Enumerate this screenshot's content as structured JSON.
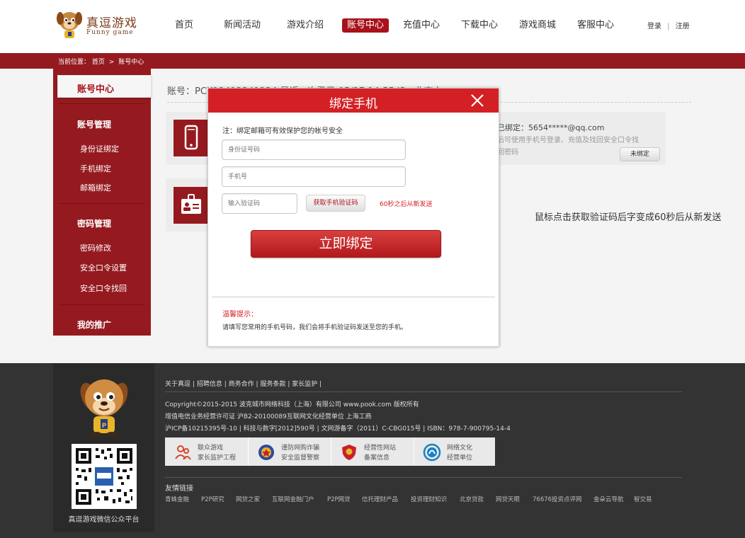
{
  "logo": {
    "cn": "真逗游戏",
    "en": "Funny game"
  },
  "nav": [
    {
      "label": "首页",
      "active": false
    },
    {
      "label": "新闻活动",
      "active": false
    },
    {
      "label": "游戏介绍",
      "active": false
    },
    {
      "label": "账号中心",
      "active": true
    },
    {
      "label": "充值中心",
      "active": false
    },
    {
      "label": "下载中心",
      "active": false
    },
    {
      "label": "游戏商城",
      "active": false
    },
    {
      "label": "客服中心",
      "active": false
    }
  ],
  "auth": {
    "login": "登录",
    "divider": "|",
    "register": "注册"
  },
  "breadcrumb": {
    "prefix": "当前位置：",
    "home": "首页",
    "sep": ">",
    "current": "账号中心"
  },
  "sidebar": {
    "active": "账号中心",
    "group1": {
      "title": "账号管理",
      "items": [
        "身份证绑定",
        "手机绑定",
        "邮箱绑定"
      ]
    },
    "group2": {
      "title": "密码管理",
      "items": [
        "密码修改",
        "安全口令设置",
        "安全口令找回"
      ]
    },
    "group3": {
      "title": "我的推广"
    }
  },
  "account": {
    "info": "账号：PCK12412341234    最近一次登录 05/27 14:55    IP：北京市"
  },
  "phone_card": {
    "bound": "已绑定：5654*****@qq.com",
    "desc": "后可使用手机号登录、充值及找回安全口令找回密码",
    "button": "未绑定"
  },
  "annotation": "鼠标点击获取验证码后字变成60秒后从新发送",
  "modal": {
    "title": "绑定手机",
    "note": "注：绑定邮箱可有效保护您的帐号安全",
    "id_placeholder": "身份证号码",
    "phone_placeholder": "手机号",
    "code_placeholder": "输入验证码",
    "get_code": "获取手机验证码",
    "resend_tip": "60秒之后从新发送",
    "submit": "立即绑定",
    "tip_title": "温馨提示：",
    "tip_text": "请填写您常用的手机号码，我们会将手机验证码发送至您的手机。"
  },
  "footer": {
    "links": [
      "关于真逗",
      "招聘信息",
      "商务合作",
      "服务条款",
      "家长监护"
    ],
    "copy": [
      "Copyright©2015-2015  波克城市网络科技（上海）有限公司 www.pook.com 版权所有",
      "增值电信业务经营许可证 沪B2-20100089互联网文化经营单位   上海工商",
      "沪ICP备10215395号-10 | 科技与数字[2012]590号 | 文网游备字（2011）C-CBG015号 | ISBN：978-7-900795-14-4"
    ],
    "badges": [
      {
        "l1": "联众游戏",
        "l2": "家长监护工程",
        "icon": "people-icon",
        "color": "#d8452c"
      },
      {
        "l1": "谨防网购诈骗",
        "l2": "安全监督警察",
        "icon": "police-badge-icon",
        "color": "#2f4a9a"
      },
      {
        "l1": "经营性网站",
        "l2": "备案信息",
        "icon": "shield-emblem-icon",
        "color": "#c8202a"
      },
      {
        "l1": "网络文化",
        "l2": "经营单位",
        "icon": "culture-circle-icon",
        "color": "#1b7fc4"
      }
    ],
    "qr_caption": "真逗游戏微信公众平台",
    "friend_title": "友情链接",
    "friends": [
      "青蛛金融",
      "P2P研究",
      "网贷之家",
      "互联网金融门户",
      "P2P网贷",
      "信托理财产品",
      "投资理财知识",
      "北京贷款",
      "网贷天眼",
      "76676投资点评网",
      "金朵云导航",
      "智交易"
    ]
  },
  "colors": {
    "brand": "#951a1f",
    "accent": "#d32025",
    "footer": "#333333"
  }
}
